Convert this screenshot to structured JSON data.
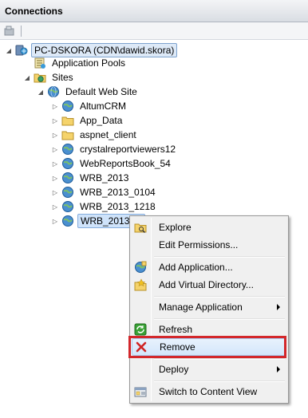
{
  "panel": {
    "title": "Connections"
  },
  "tree": {
    "server": "PC-DSKORA (CDN\\dawid.skora)",
    "app_pools": "Application Pools",
    "sites": "Sites",
    "default_site": "Default Web Site",
    "children": [
      {
        "label": "AltumCRM",
        "icon": "globe-icon"
      },
      {
        "label": "App_Data",
        "icon": "folder-icon"
      },
      {
        "label": "aspnet_client",
        "icon": "folder-icon"
      },
      {
        "label": "crystalreportviewers12",
        "icon": "globe-icon"
      },
      {
        "label": "WebReportsBook_54",
        "icon": "globe-icon"
      },
      {
        "label": "WRB_2013",
        "icon": "globe-icon"
      },
      {
        "label": "WRB_2013_0104",
        "icon": "globe-icon"
      },
      {
        "label": "WRB_2013_1218",
        "icon": "globe-icon"
      },
      {
        "label": "WRB_20132",
        "icon": "globe-icon"
      }
    ]
  },
  "context_menu": {
    "explore": "Explore",
    "edit_permissions": "Edit Permissions...",
    "add_application": "Add Application...",
    "add_virtual_directory": "Add Virtual Directory...",
    "manage_application": "Manage Application",
    "refresh": "Refresh",
    "remove": "Remove",
    "deploy": "Deploy",
    "switch_content_view": "Switch to Content View"
  },
  "colors": {
    "highlight": "#d3272b",
    "selection": "#cfe3fa"
  }
}
